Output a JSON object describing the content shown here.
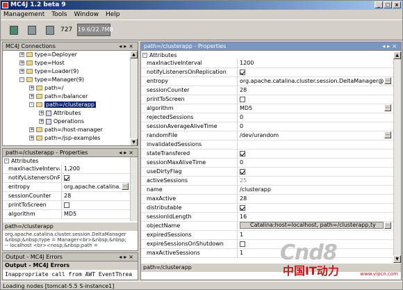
{
  "window": {
    "title": "MC4J 1.2 beta 9"
  },
  "menu": [
    "Management",
    "Tools",
    "Window",
    "Help"
  ],
  "toolbar": {
    "count": "727",
    "memory": "19.6/22.7MB"
  },
  "connections": {
    "title": "MC4J Connections",
    "items": [
      {
        "label": "type=Deployer",
        "kind": "folder",
        "indent": 1,
        "expander": "+"
      },
      {
        "label": "type=Host",
        "kind": "folder",
        "indent": 1,
        "expander": "+"
      },
      {
        "label": "type=Loader(9)",
        "kind": "folder",
        "indent": 1,
        "expander": "+"
      },
      {
        "label": "type=Manager(9)",
        "kind": "folder",
        "indent": 1,
        "expander": "-"
      },
      {
        "label": "path=/",
        "kind": "folder",
        "indent": 2,
        "expander": "+"
      },
      {
        "label": "path=/balancer",
        "kind": "folder",
        "indent": 2,
        "expander": "+"
      },
      {
        "label": "path=/clusterapp",
        "kind": "folder",
        "indent": 2,
        "expander": "-",
        "selected": true
      },
      {
        "label": "Attributes",
        "kind": "object",
        "indent": 3,
        "expander": "+"
      },
      {
        "label": "Operations",
        "kind": "object",
        "indent": 3,
        "expander": "+"
      },
      {
        "label": "path=/host-manager",
        "kind": "folder",
        "indent": 2,
        "expander": "+"
      },
      {
        "label": "path=/jsp-examples",
        "kind": "folder",
        "indent": 2,
        "expander": "+"
      }
    ]
  },
  "mini_props": {
    "title": "path=/clusterapp - Properties",
    "section": "Attributes",
    "rows": [
      {
        "name": "maxInactiveInterval",
        "value": "1,200",
        "type": "text"
      },
      {
        "name": "notifyListenersOnRepl",
        "value": "",
        "type": "checkbox",
        "checked": true
      },
      {
        "name": "entropy",
        "value": "org.apache.catalina.cl",
        "type": "text",
        "ellipsis": true
      },
      {
        "name": "sessionCounter",
        "value": "28",
        "type": "text"
      },
      {
        "name": "printToScreen",
        "value": "",
        "type": "checkbox",
        "checked": false
      },
      {
        "name": "algorithm",
        "value": "MD5",
        "type": "text"
      }
    ],
    "desc_title": "path=/clusterapp",
    "desc_lines": [
      "org.apache.catalina.cluster.session.DeltaManager",
      "&nbsp;&nbsp;type = Manager<br>&nbsp;&nbsp;",
      "-- localhost <br><nosp;&nbsp;path ="
    ]
  },
  "output": {
    "tab_title": "Output - MC4J Errors",
    "text": "Inappropriate call from AWT EventThrea"
  },
  "main_props": {
    "title": "path=/clusterapp - Properties",
    "section": "Attributes",
    "rows": [
      {
        "name": "maxInactiveInterval",
        "value": "1200",
        "type": "text"
      },
      {
        "name": "notifyListenersOnReplication",
        "value": "",
        "type": "checkbox",
        "checked": true
      },
      {
        "name": "entropy",
        "value": "org.apache.catalina.cluster.session.DeltaManager@5e5",
        "type": "text",
        "ellipsis": true
      },
      {
        "name": "sessionCounter",
        "value": "28",
        "type": "text"
      },
      {
        "name": "printToScreen",
        "value": "",
        "type": "checkbox",
        "checked": false
      },
      {
        "name": "algorithm",
        "value": "MD5",
        "type": "text",
        "ellipsis": true
      },
      {
        "name": "rejectedSessions",
        "value": "0",
        "type": "text"
      },
      {
        "name": "sessionAverageAliveTime",
        "value": "0",
        "type": "text"
      },
      {
        "name": "randomFile",
        "value": "/dev/urandom",
        "type": "text",
        "ellipsis": true
      },
      {
        "name": "invalidatedSessions",
        "value": "",
        "type": "text"
      },
      {
        "name": "stateTransfered",
        "value": "",
        "type": "checkbox",
        "checked": true
      },
      {
        "name": "sessionMaxAliveTime",
        "value": "0",
        "type": "text"
      },
      {
        "name": "useDirtyFlag",
        "value": "",
        "type": "checkbox",
        "checked": true
      },
      {
        "name": "activeSessions",
        "value": "25",
        "type": "text",
        "muted": true
      },
      {
        "name": "name",
        "value": "/clusterapp",
        "type": "text"
      },
      {
        "name": "maxActive",
        "value": "28",
        "type": "text"
      },
      {
        "name": "distributable",
        "value": "",
        "type": "checkbox",
        "checked": true
      },
      {
        "name": "sessionIdLength",
        "value": "16",
        "type": "text"
      },
      {
        "name": "objectName",
        "value": "Catalina:host=localhost, path=/clusterapp,ty",
        "type": "button"
      },
      {
        "name": "expiredSessions",
        "value": "1",
        "type": "text"
      },
      {
        "name": "expireSessionsOnShutdown",
        "value": "",
        "type": "checkbox",
        "checked": false
      },
      {
        "name": "maxActiveSessions",
        "value": "1",
        "type": "text"
      }
    ],
    "desc_title": "path=/clusterapp"
  },
  "status": {
    "text": "Loading nodes [tomcat-5.5 S-instance1]"
  },
  "watermark": {
    "brand": "Cnd8",
    "tagline": "中国IT动力",
    "url": "www.vipcn.com"
  }
}
